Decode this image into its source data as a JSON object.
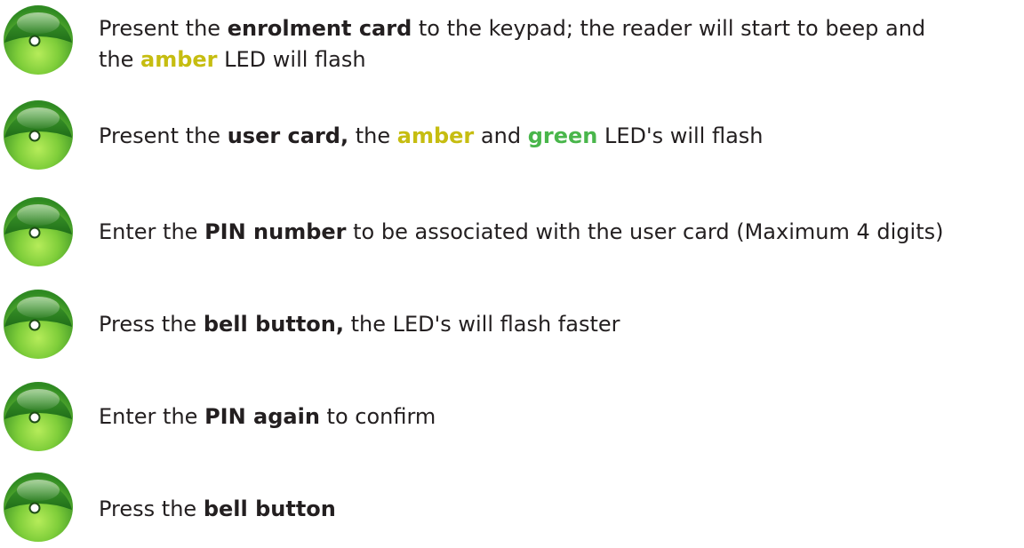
{
  "colors": {
    "text": "#231f20",
    "amber": "#c6bd11",
    "green": "#49b64b",
    "bullet_dark": "#2a7d1e",
    "bullet_light": "#8fdc3f"
  },
  "bullet_icon": "green-circle-bullet-icon",
  "steps": [
    {
      "t1": "Present the ",
      "b1": "enrolment card",
      "t2": " to the keypad; the reader will start to beep and",
      "t3": "the ",
      "amber": "amber",
      "t4": " LED will flash"
    },
    {
      "t1": "Present the ",
      "b1": "user card,",
      "t2": " the ",
      "amber": "amber",
      "t3": " and ",
      "green": "green",
      "t4": " LED's will flash"
    },
    {
      "t1": "Enter the ",
      "b1": "PIN number",
      "t2": " to be associated with the user card  (Maximum 4 digits)"
    },
    {
      "t1": "Press the ",
      "b1": "bell button,",
      "t2": " the LED's will flash faster"
    },
    {
      "t1": "Enter the ",
      "b1": "PIN again",
      "t2": " to confirm"
    },
    {
      "t1": "Press the ",
      "b1": "bell button"
    }
  ]
}
